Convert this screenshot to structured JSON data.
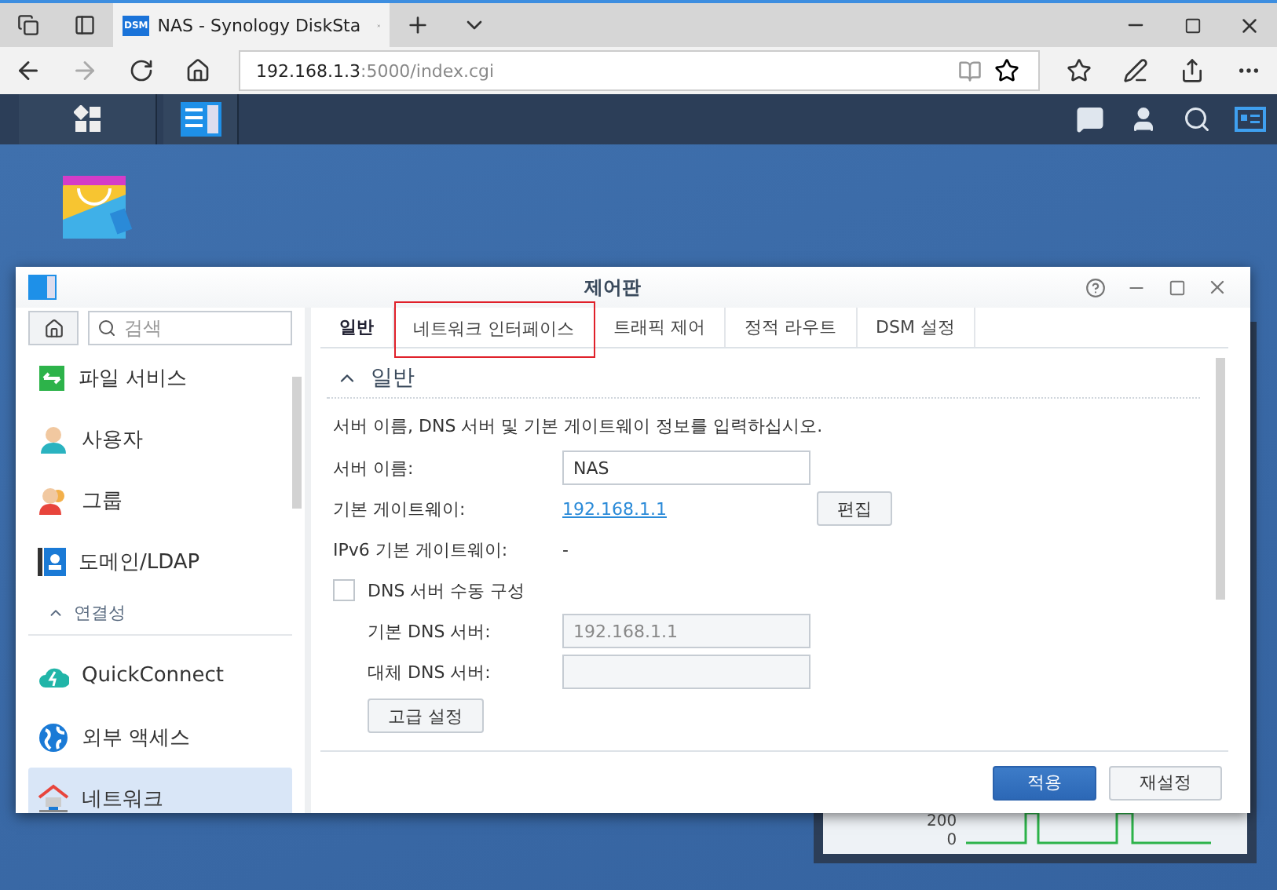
{
  "browser": {
    "tab_title": "NAS - Synology DiskSta",
    "tab_badge": "DSM",
    "url_host": "192.168.1.3",
    "url_rest": ":5000/index.cgi"
  },
  "widget": {
    "ticks": [
      "200",
      "0"
    ]
  },
  "window": {
    "title": "제어판",
    "search": {
      "placeholder": "검색"
    },
    "sidebar": [
      {
        "kind": "item",
        "label": "파일 서비스",
        "selected": false
      },
      {
        "kind": "item",
        "label": "사용자",
        "selected": false
      },
      {
        "kind": "item",
        "label": "그룹",
        "selected": false
      },
      {
        "kind": "item",
        "label": "도메인/LDAP",
        "selected": false
      },
      {
        "kind": "header",
        "label": "연결성",
        "expanded": true
      },
      {
        "kind": "item",
        "label": "QuickConnect",
        "selected": false
      },
      {
        "kind": "item",
        "label": "외부 액세스",
        "selected": false
      },
      {
        "kind": "item",
        "label": "네트워크",
        "selected": true
      }
    ],
    "tabs": [
      {
        "label": "일반",
        "selected": true,
        "highlighted": false
      },
      {
        "label": "네트워크 인터페이스",
        "selected": false,
        "highlighted": true
      },
      {
        "label": "트래픽 제어",
        "selected": false,
        "highlighted": false
      },
      {
        "label": "정적 라우트",
        "selected": false,
        "highlighted": false
      },
      {
        "label": "DSM 설정",
        "selected": false,
        "highlighted": false
      }
    ],
    "section": {
      "title": "일반",
      "expanded": true
    },
    "description": "서버 이름, DNS 서버 및 기본 게이트웨이 정보를 입력하십시오.",
    "fields": [
      {
        "kind": "input",
        "label": "서버 이름:",
        "value": "NAS"
      },
      {
        "kind": "link",
        "label": "기본 게이트웨이:",
        "value": "192.168.1.1",
        "button": "편집"
      },
      {
        "kind": "text",
        "label": "IPv6 기본 게이트웨이:",
        "value": "-"
      }
    ],
    "dns": {
      "label": "DNS 서버 수동 구성",
      "checked": false,
      "fields": [
        {
          "label": "기본 DNS 서버:",
          "value": "192.168.1.1"
        },
        {
          "label": "대체 DNS 서버:"
        }
      ]
    },
    "advanced_button": "고급 설정",
    "buttons": [
      {
        "label": "적용",
        "primary": true
      },
      {
        "label": "재설정",
        "primary": false
      }
    ]
  }
}
